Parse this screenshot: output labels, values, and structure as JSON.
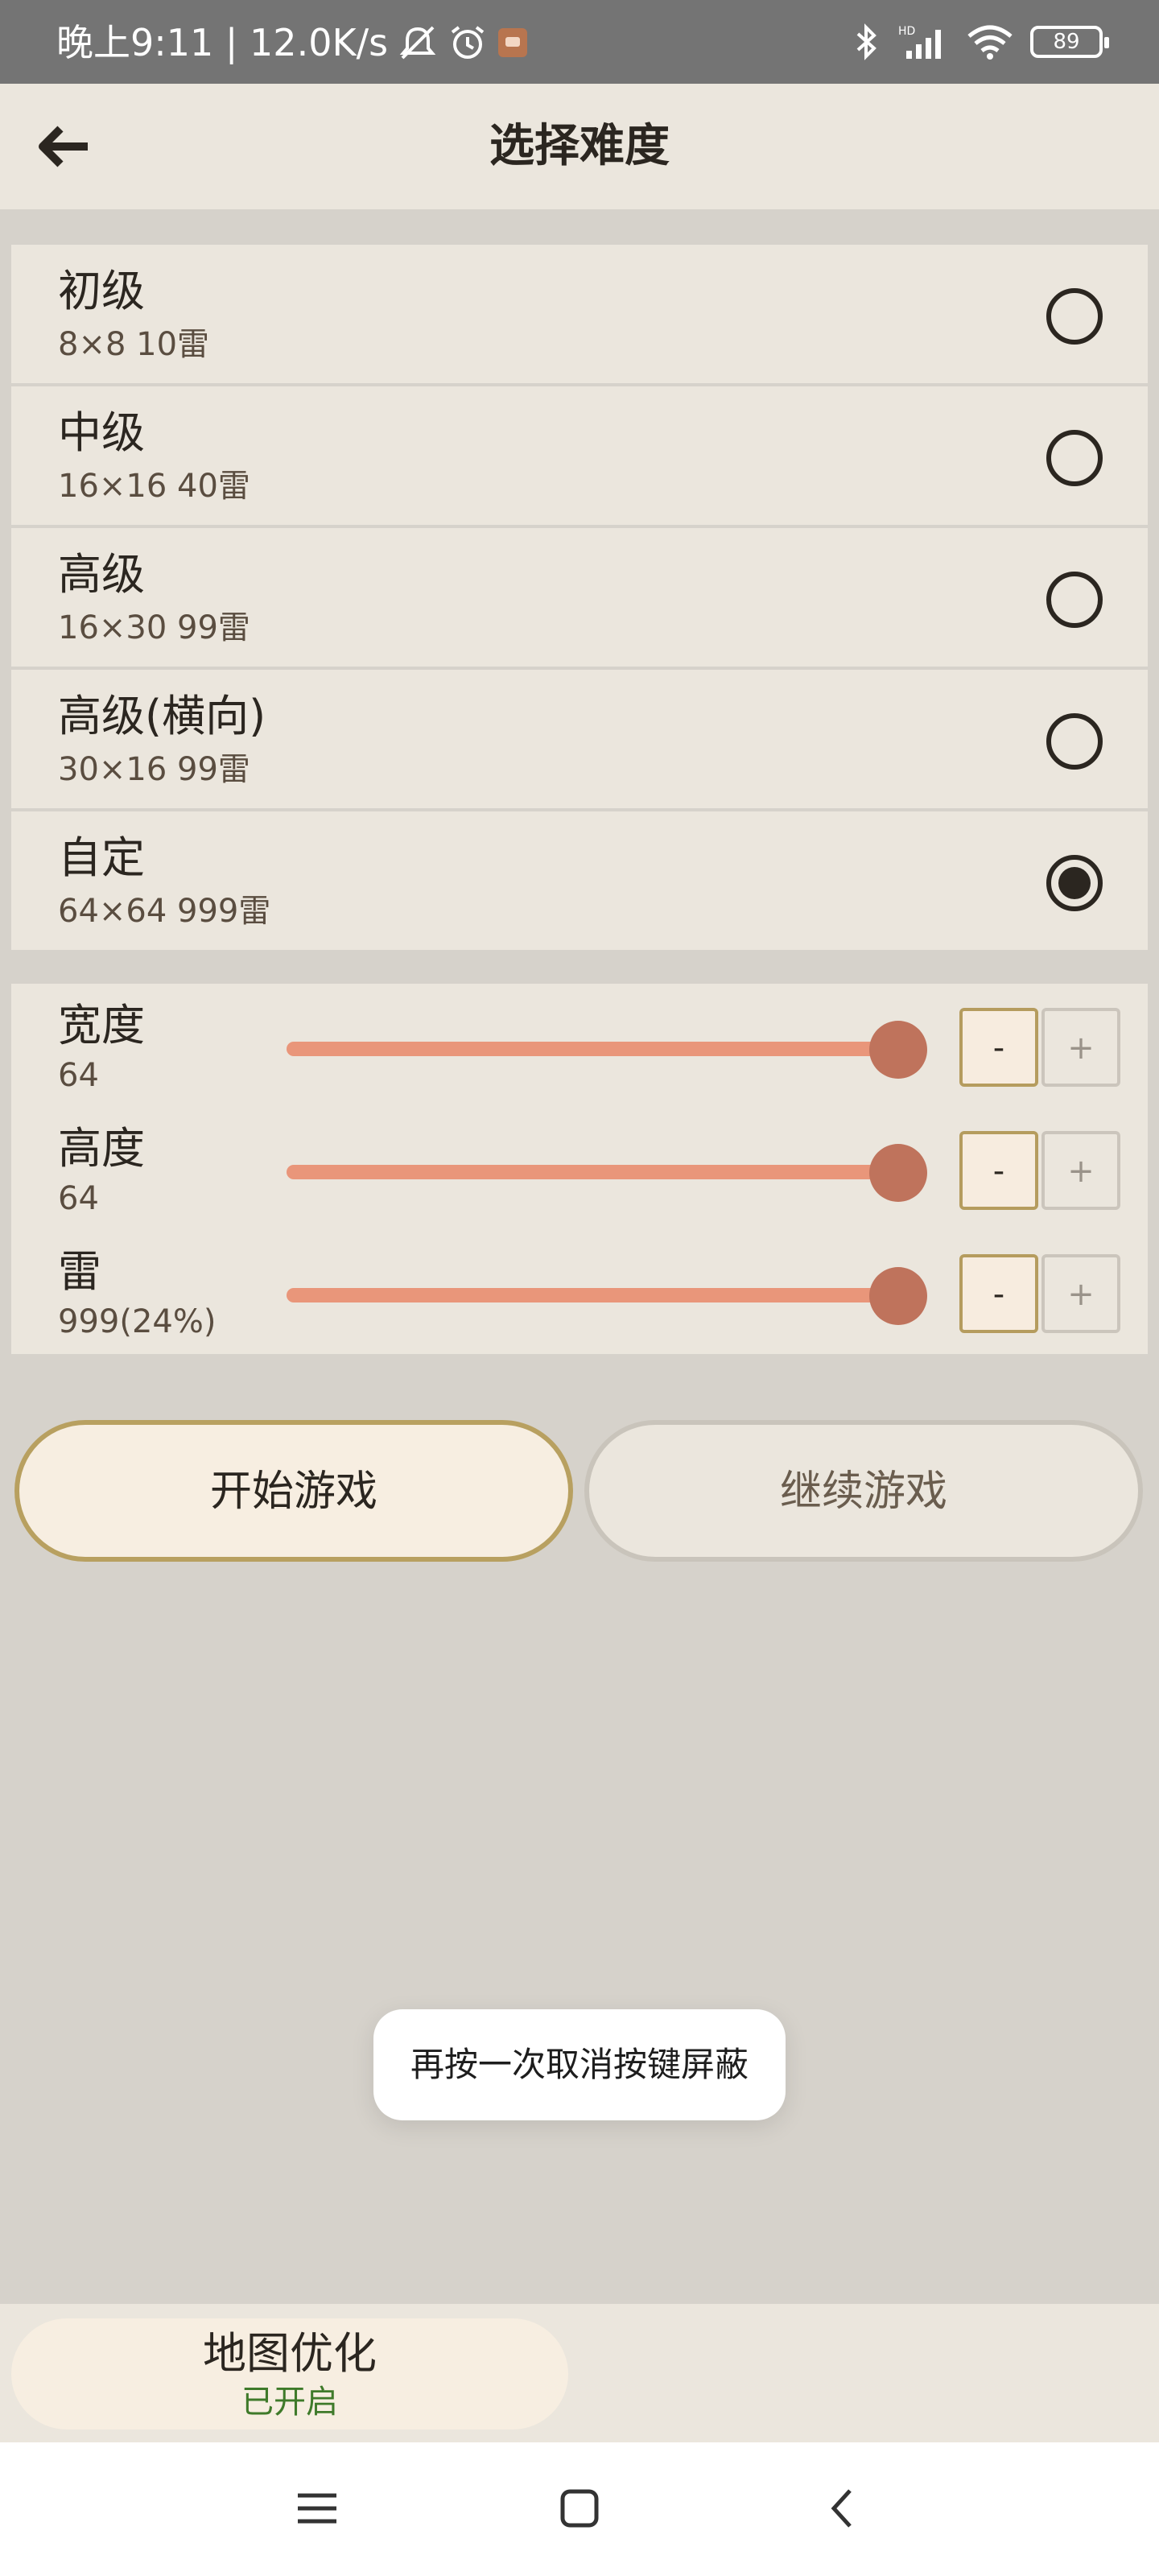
{
  "status_bar": {
    "left_text": "晚上9:11 | 12.0K/s",
    "battery": "89",
    "icons": [
      "mute-bell-icon",
      "alarm-icon",
      "app-notification-icon",
      "bluetooth-icon",
      "hd-signal-icon",
      "wifi-icon",
      "battery-icon"
    ]
  },
  "app_bar": {
    "title": "选择难度",
    "back_icon": "back-arrow-icon"
  },
  "difficulties": [
    {
      "title": "初级",
      "sub": "8×8  10雷",
      "selected": false
    },
    {
      "title": "中级",
      "sub": "16×16  40雷",
      "selected": false
    },
    {
      "title": "高级",
      "sub": "16×30  99雷",
      "selected": false
    },
    {
      "title": "高级(横向)",
      "sub": "30×16  99雷",
      "selected": false
    },
    {
      "title": "自定",
      "sub": "64×64  999雷",
      "selected": true
    }
  ],
  "sliders": [
    {
      "label": "宽度",
      "value": "64",
      "fraction": 1.0,
      "minus": "-",
      "plus": "+"
    },
    {
      "label": "高度",
      "value": "64",
      "fraction": 1.0,
      "minus": "-",
      "plus": "+"
    },
    {
      "label": "雷",
      "value": "999(24%)",
      "fraction": 1.0,
      "minus": "-",
      "plus": "+"
    }
  ],
  "buttons": {
    "start": "开始游戏",
    "continue": "继续游戏"
  },
  "toast": "再按一次取消按键屏蔽",
  "map_option": {
    "title": "地图优化",
    "status": "已开启"
  },
  "nav": {
    "icons": [
      "menu-icon",
      "home-square-icon",
      "back-chevron-icon"
    ]
  },
  "colors": {
    "background": "#d6d2cb",
    "panel": "#ebe6dd",
    "slider_fill": "#e9967a",
    "slider_thumb": "#bf735c",
    "accent_border": "#b8a060",
    "status_green": "#3f7a2a"
  }
}
